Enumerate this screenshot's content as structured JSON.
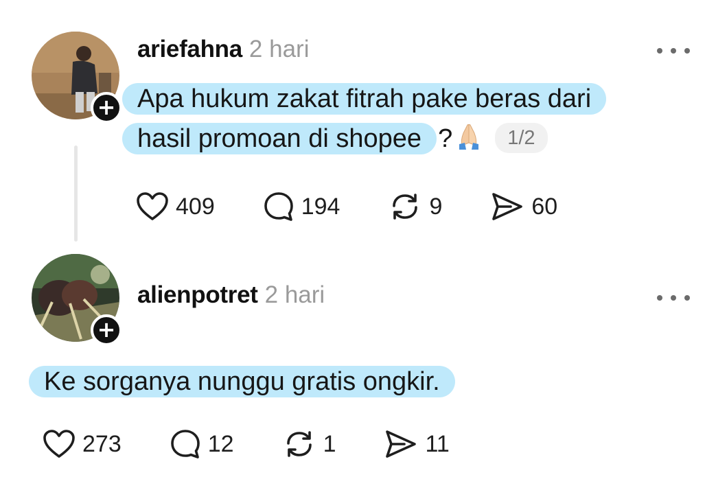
{
  "posts": [
    {
      "username": "ariefahna",
      "time": "2 hari",
      "text_line1": "Apa hukum zakat fitrah pake beras dari",
      "text_line2": "hasil promoan di shopee",
      "text_suffix": "?",
      "emoji": "praying-hands",
      "pager": "1/2",
      "likes": "409",
      "replies": "194",
      "reposts": "9",
      "shares": "60"
    },
    {
      "username": "alienpotret",
      "time": "2 hari",
      "text_line1": "Ke sorganya nunggu gratis ongkir.",
      "likes": "273",
      "replies": "12",
      "reposts": "1",
      "shares": "11"
    }
  ],
  "follow_badge": "+",
  "colors": {
    "highlight": "#bfe9fb",
    "muted_text": "#9a9a9a",
    "thread_line": "#e6e6e6"
  }
}
